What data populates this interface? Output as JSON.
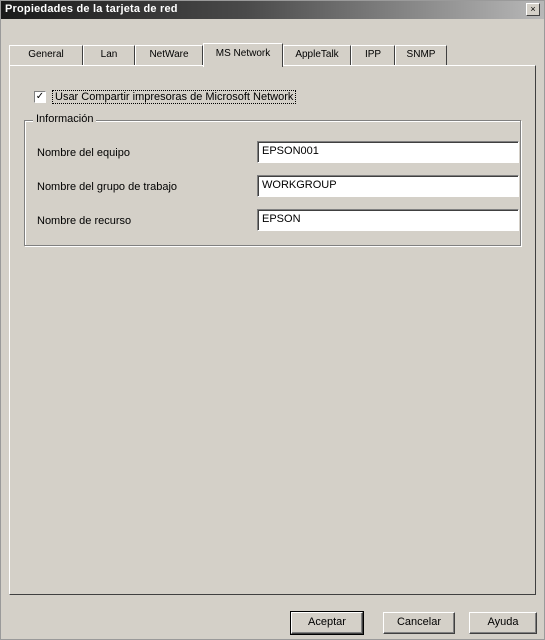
{
  "window": {
    "title": "Propiedades de la tarjeta de red",
    "close_glyph": "×"
  },
  "tabs": [
    {
      "label": "General"
    },
    {
      "label": "Lan"
    },
    {
      "label": "NetWare"
    },
    {
      "label": "MS Network"
    },
    {
      "label": "AppleTalk"
    },
    {
      "label": "IPP"
    },
    {
      "label": "SNMP"
    }
  ],
  "active_tab_index": 3,
  "checkbox": {
    "label": "Usar Compartir impresoras de Microsoft Network",
    "checked": true,
    "check_glyph": "✓"
  },
  "groupbox": {
    "legend": "Información",
    "fields": [
      {
        "label": "Nombre del equipo",
        "value": "EPSON001"
      },
      {
        "label": "Nombre del grupo de trabajo",
        "value": "WORKGROUP"
      },
      {
        "label": "Nombre de recurso",
        "value": "EPSON"
      }
    ]
  },
  "buttons": {
    "ok": "Aceptar",
    "cancel": "Cancelar",
    "help": "Ayuda"
  }
}
